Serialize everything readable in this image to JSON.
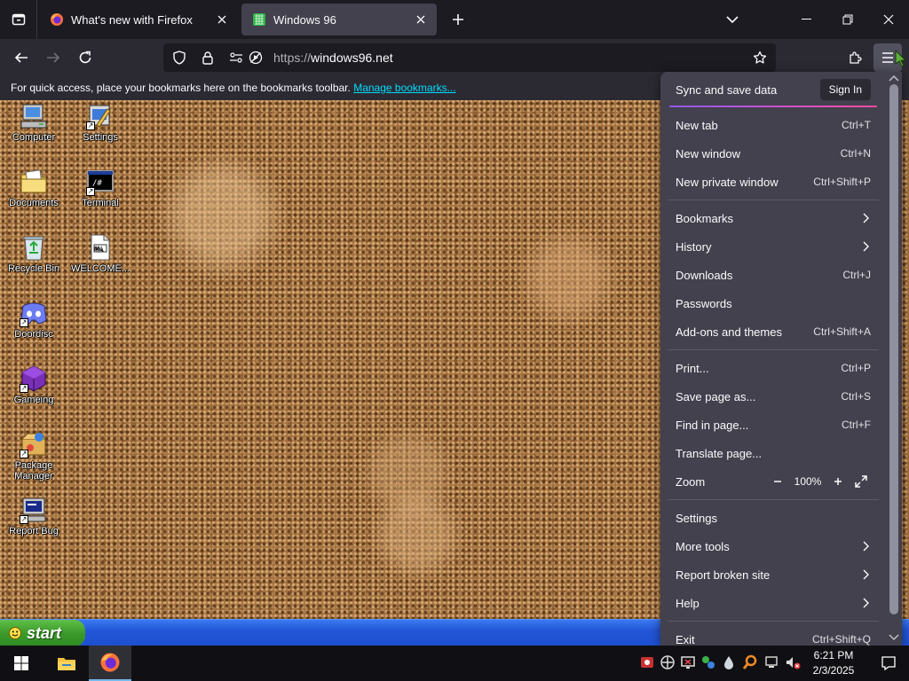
{
  "browser": {
    "tabs": [
      {
        "title": "What's new with Firefox",
        "icon": "firefox-icon",
        "active": false
      },
      {
        "title": "Windows 96",
        "icon": "windows96-icon",
        "active": true
      }
    ],
    "url": {
      "protocol": "https://",
      "host": "windows96.net"
    }
  },
  "bookmarks_bar": {
    "message": "For quick access, place your bookmarks here on the bookmarks toolbar.",
    "link": "Manage bookmarks..."
  },
  "desktop": {
    "icons": [
      {
        "label": "Computer",
        "icon": "computer-icon"
      },
      {
        "label": "Settings",
        "icon": "settings-icon"
      },
      {
        "label": "Documents",
        "icon": "documents-folder-icon"
      },
      {
        "label": "Terminal",
        "icon": "terminal-icon"
      },
      {
        "label": "Recycle Bin",
        "icon": "recycle-bin-icon"
      },
      {
        "label": "WELCOME...",
        "icon": "markdown-file-icon",
        "badge": "M↓"
      },
      {
        "label": "Doordisc",
        "icon": "doordisc-icon"
      },
      {
        "label": "Gameing",
        "icon": "gameing-cube-icon"
      },
      {
        "label": "Package Manager",
        "icon": "package-manager-icon"
      },
      {
        "label": "Report Bug",
        "icon": "report-bug-icon"
      }
    ],
    "terminal_glyph": "/#",
    "start_label": "start"
  },
  "app_menu": {
    "sync_label": "Sync and save data",
    "sign_in_label": "Sign In",
    "group1": [
      {
        "label": "New tab",
        "shortcut": "Ctrl+T"
      },
      {
        "label": "New window",
        "shortcut": "Ctrl+N"
      },
      {
        "label": "New private window",
        "shortcut": "Ctrl+Shift+P"
      }
    ],
    "group2": [
      {
        "label": "Bookmarks",
        "submenu": true
      },
      {
        "label": "History",
        "submenu": true
      },
      {
        "label": "Downloads",
        "shortcut": "Ctrl+J"
      },
      {
        "label": "Passwords"
      },
      {
        "label": "Add-ons and themes",
        "shortcut": "Ctrl+Shift+A"
      }
    ],
    "group3": [
      {
        "label": "Print...",
        "shortcut": "Ctrl+P"
      },
      {
        "label": "Save page as...",
        "shortcut": "Ctrl+S"
      },
      {
        "label": "Find in page...",
        "shortcut": "Ctrl+F"
      },
      {
        "label": "Translate page..."
      }
    ],
    "zoom": {
      "label": "Zoom",
      "value": "100%"
    },
    "group4": [
      {
        "label": "Settings"
      },
      {
        "label": "More tools",
        "submenu": true
      },
      {
        "label": "Report broken site",
        "submenu": true
      },
      {
        "label": "Help",
        "submenu": true
      }
    ],
    "exit": {
      "label": "Exit",
      "shortcut": "Ctrl+Shift+Q"
    }
  },
  "taskbar": {
    "time": "6:21 PM",
    "date": "2/3/2025"
  },
  "colors": {
    "accent_link": "#00ddff",
    "menu_bg": "#42414d",
    "toolbar_bg": "#2b2a33",
    "tabstrip_bg": "#1c1b22"
  }
}
